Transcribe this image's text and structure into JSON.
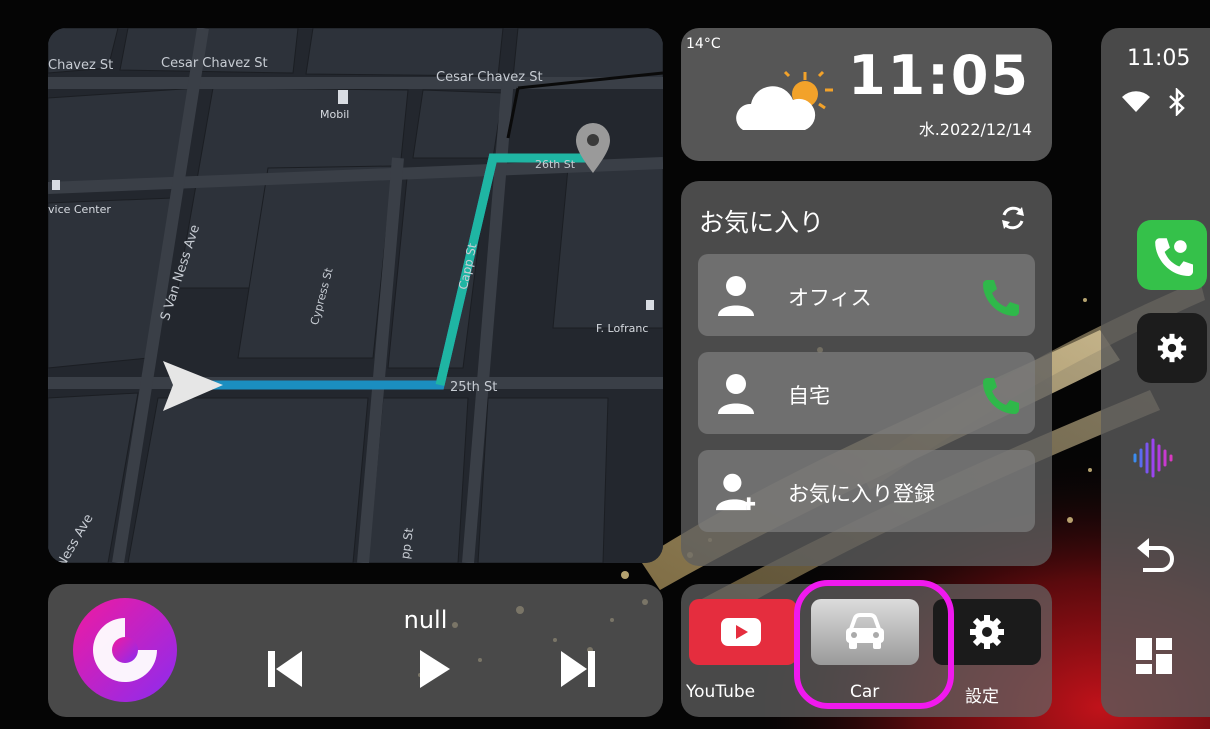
{
  "map": {
    "streets": {
      "cesar_chavez_1": "Chavez St",
      "cesar_chavez_2": "Cesar Chavez St",
      "cesar_chavez_3": "Cesar Chavez St",
      "s_van_ness": "S Van Ness Ave",
      "cypress": "Cypress St",
      "capp": "Capp St",
      "capp_2": "pp St",
      "twentyfifth": "25th St",
      "twentysixth": "26th St",
      "ness_ave": "Ness Ave"
    },
    "pois": {
      "mobil": "Mobil",
      "service_center": "vice Center",
      "lofranco": "F. Lofranc"
    },
    "route_color": "#1fb5a3",
    "route_color_2": "#1b8ec0"
  },
  "clock": {
    "temperature": "14°C",
    "time": "11:05",
    "date": "水.2022/12/14",
    "weather_icon": "partly-cloudy-icon"
  },
  "favorites": {
    "title": "お気に入り",
    "items": [
      {
        "label": "オフィス",
        "icon": "person-icon",
        "action_icon": "phone-icon"
      },
      {
        "label": "自宅",
        "icon": "person-icon",
        "action_icon": "phone-icon"
      },
      {
        "label": "お気に入り登録",
        "icon": "add-person-icon"
      }
    ]
  },
  "player": {
    "track_title": "null",
    "album_color_start": "#f01aa0",
    "album_color_end": "#8b2cf0"
  },
  "apps": [
    {
      "label": "YouTube",
      "icon": "youtube-icon",
      "color": "#e52d3e"
    },
    {
      "label": "Car",
      "icon": "car-icon",
      "color": "#d8d8d8"
    },
    {
      "label": "設定",
      "icon": "gear-icon",
      "color": "#1b1b1b"
    }
  ],
  "sidebar": {
    "time": "11:05",
    "phone_color": "#35c14a",
    "highlight_color": "#f019ee"
  }
}
